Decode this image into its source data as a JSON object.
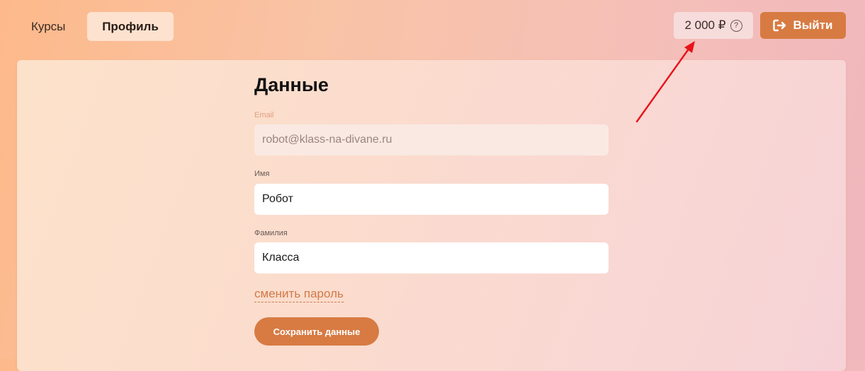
{
  "nav": {
    "courses_label": "Курсы",
    "profile_label": "Профиль"
  },
  "header": {
    "balance": "2 000 ₽",
    "help_symbol": "?",
    "logout_label": "Выйти",
    "logout_icon": "logout-icon"
  },
  "form": {
    "title": "Данные",
    "email": {
      "label": "Email",
      "value": "robot@klass-na-divane.ru",
      "disabled": true
    },
    "first_name": {
      "label": "Имя",
      "value": "Робот"
    },
    "last_name": {
      "label": "Фамилия",
      "value": "Класса"
    },
    "change_password_label": "сменить пароль",
    "save_label": "Сохранить данные"
  },
  "colors": {
    "accent": "#d77b43",
    "annotation_arrow": "#e8121a"
  }
}
